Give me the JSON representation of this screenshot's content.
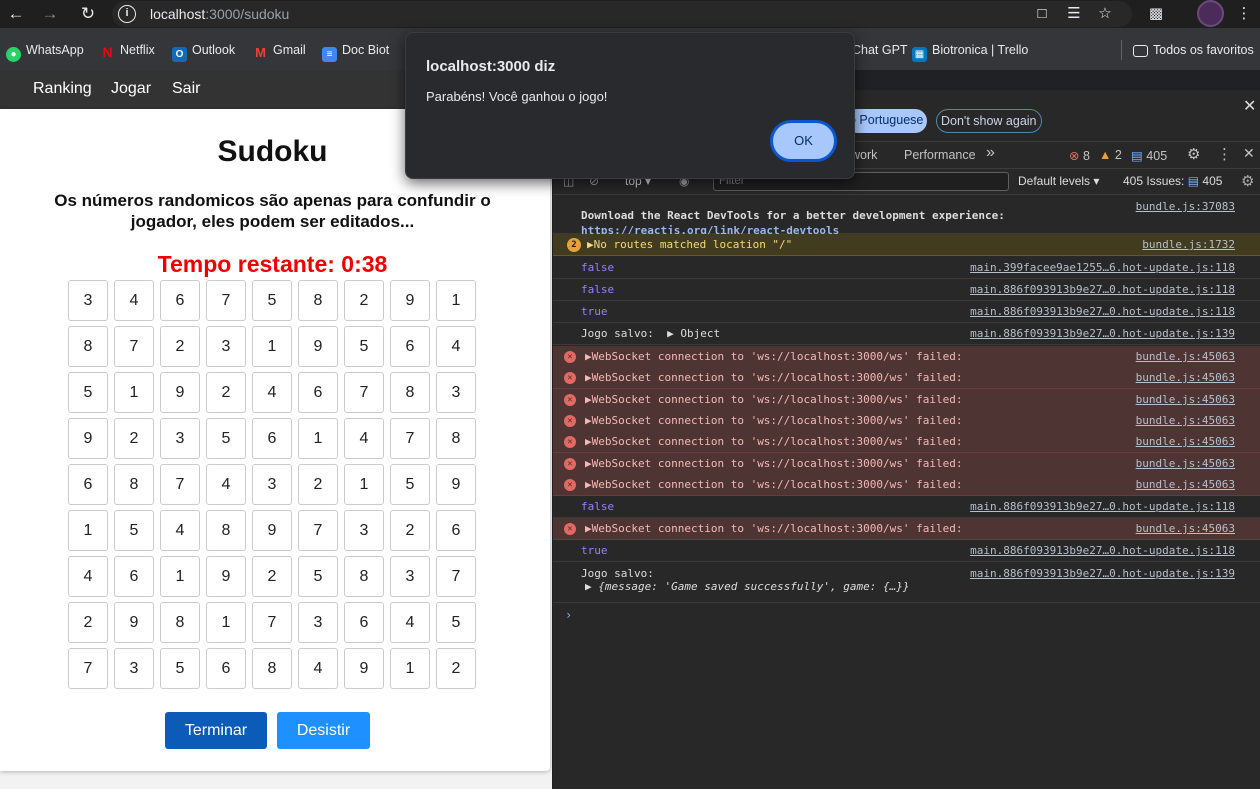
{
  "browser": {
    "url_host": "localhost",
    "url_path": ":3000/sudoku",
    "bookmarks": [
      {
        "label": "WhatsApp",
        "icon": "whatsapp-icon",
        "color": "#25d366"
      },
      {
        "label": "Netflix",
        "icon": "netflix-icon",
        "color": "#e50914"
      },
      {
        "label": "Outlook",
        "icon": "outlook-icon",
        "color": "#0f6cbd"
      },
      {
        "label": "Gmail",
        "icon": "gmail-icon",
        "color": "#ea4335"
      },
      {
        "label": "Doc Biot",
        "icon": "docs-icon",
        "color": "#4285f4"
      },
      {
        "label": "Chat GPT",
        "icon": "chatgpt-icon",
        "color": "#10a37f"
      },
      {
        "label": "Biotronica | Trello",
        "icon": "trello-icon",
        "color": "#0079bf"
      },
      {
        "label": "Todos os favoritos",
        "icon": "folder-icon",
        "color": "#e8eaed"
      }
    ]
  },
  "site_nav": {
    "ranking": "Ranking",
    "play": "Jogar",
    "logout": "Sair"
  },
  "game": {
    "title": "Sudoku",
    "subtitle": "Os números randomicos são apenas para confundir o jogador, eles podem ser editados...",
    "timer": "Tempo restante: 0:38",
    "grid": [
      [
        3,
        4,
        6,
        7,
        5,
        8,
        2,
        9,
        1
      ],
      [
        8,
        7,
        2,
        3,
        1,
        9,
        5,
        6,
        4
      ],
      [
        5,
        1,
        9,
        2,
        4,
        6,
        7,
        8,
        3
      ],
      [
        9,
        2,
        3,
        5,
        6,
        1,
        4,
        7,
        8
      ],
      [
        6,
        8,
        7,
        4,
        3,
        2,
        1,
        5,
        9
      ],
      [
        1,
        5,
        4,
        8,
        9,
        7,
        3,
        2,
        6
      ],
      [
        4,
        6,
        1,
        9,
        2,
        5,
        8,
        3,
        7
      ],
      [
        2,
        9,
        8,
        1,
        7,
        3,
        6,
        4,
        5
      ],
      [
        7,
        3,
        5,
        6,
        8,
        4,
        9,
        1,
        2
      ]
    ],
    "finish_button": "Terminar",
    "quit_button": "Desistir"
  },
  "alert": {
    "title": "localhost:3000 diz",
    "message": "Parabéns! Você ganhou o jogo!",
    "ok": "OK"
  },
  "devtools": {
    "lang_button": "o Portuguese",
    "dont_show": "Don't show again",
    "tabs": {
      "network": "work",
      "performance": "Performance",
      "more": "»"
    },
    "errors": "8",
    "warnings": "2",
    "issues_badge": "405",
    "context": "top",
    "filter_placeholder": "Filter",
    "levels": "Default levels",
    "issues_label": "405 Issues:",
    "issues_count": "405",
    "log": [
      {
        "type": "info",
        "text": "Download the React DevTools for a better development experience:",
        "text2": "https://reactjs.org/link/react-devtools",
        "src": "bundle.js:37083"
      },
      {
        "type": "warn",
        "count": "2",
        "text": "No routes matched location \"/\"",
        "src": "bundle.js:1732"
      },
      {
        "type": "bool",
        "text": "false",
        "src": "main.399facee9ae1255…6.hot-update.js:118"
      },
      {
        "type": "bool",
        "text": "false",
        "src": "main.886f093913b9e27…0.hot-update.js:118"
      },
      {
        "type": "bool",
        "text": "true",
        "src": "main.886f093913b9e27…0.hot-update.js:118"
      },
      {
        "type": "log",
        "text": "Jogo salvo: ",
        "text2": "Object",
        "src": "main.886f093913b9e27…0.hot-update.js:139"
      },
      {
        "type": "err",
        "text": "WebSocket connection to 'ws://localhost:3000/ws' failed:",
        "src": "bundle.js:45063"
      },
      {
        "type": "err",
        "text": "WebSocket connection to 'ws://localhost:3000/ws' failed:",
        "src": "bundle.js:45063"
      },
      {
        "type": "err",
        "text": "WebSocket connection to 'ws://localhost:3000/ws' failed:",
        "src": "bundle.js:45063"
      },
      {
        "type": "err",
        "text": "WebSocket connection to 'ws://localhost:3000/ws' failed:",
        "src": "bundle.js:45063"
      },
      {
        "type": "err",
        "text": "WebSocket connection to 'ws://localhost:3000/ws' failed:",
        "src": "bundle.js:45063"
      },
      {
        "type": "err",
        "text": "WebSocket connection to 'ws://localhost:3000/ws' failed:",
        "src": "bundle.js:45063"
      },
      {
        "type": "err",
        "text": "WebSocket connection to 'ws://localhost:3000/ws' failed:",
        "src": "bundle.js:45063"
      },
      {
        "type": "bool",
        "text": "false",
        "src": "main.886f093913b9e27…0.hot-update.js:118"
      },
      {
        "type": "err",
        "text": "WebSocket connection to 'ws://localhost:3000/ws' failed:",
        "src": "bundle.js:45063"
      },
      {
        "type": "bool",
        "text": "true",
        "src": "main.886f093913b9e27…0.hot-update.js:118"
      },
      {
        "type": "obj",
        "text": "Jogo salvo:",
        "text2": "{message: 'Game saved successfully', game: {…}}",
        "src": "main.886f093913b9e27…0.hot-update.js:139"
      }
    ]
  }
}
